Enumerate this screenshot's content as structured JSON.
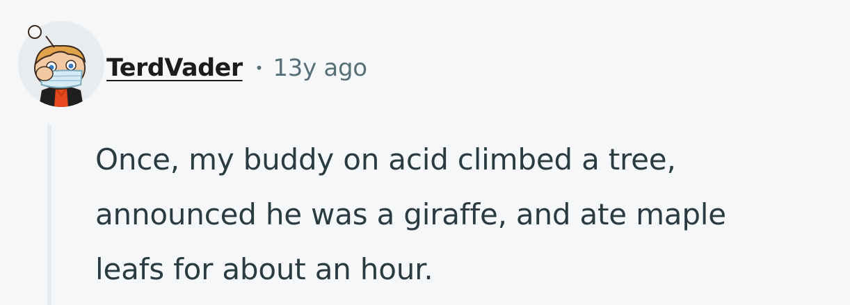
{
  "comment": {
    "author": "TerdVader",
    "separator": "•",
    "timestamp": "13y ago",
    "avatar_icon": "snoo-avatar-icon",
    "body_lines": [
      "Once, my buddy on acid climbed a tree,",
      "announced he was a giraffe, and ate maple",
      "leafs for about an hour."
    ]
  },
  "colors": {
    "background": "#f6f7f8",
    "author": "#1c1c1c",
    "meta": "#576f76",
    "body": "#2a3c42",
    "thread_line": "#e5ebee"
  }
}
